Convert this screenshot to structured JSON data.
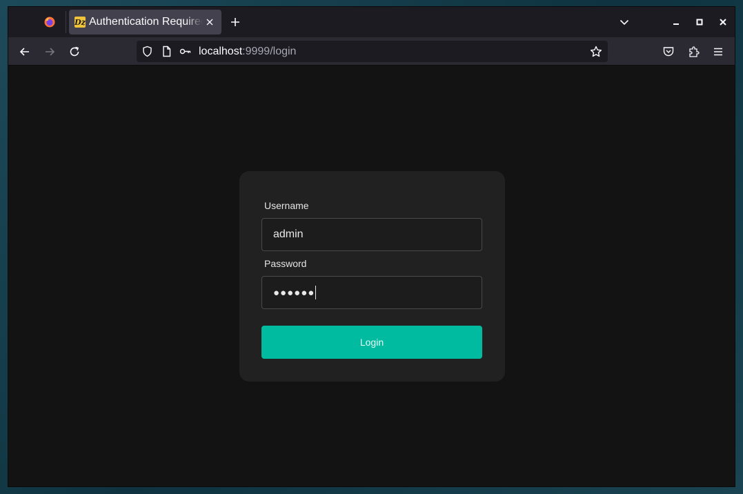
{
  "browser": {
    "tab": {
      "title": "Authentication Required",
      "favicon_text": "Dz"
    },
    "url": {
      "host": "localhost",
      "rest": ":9999/login"
    }
  },
  "login": {
    "username_label": "Username",
    "username_value": "admin",
    "password_label": "Password",
    "password_mask": "●●●●●●",
    "button_label": "Login"
  },
  "colors": {
    "accent": "#00bba0",
    "card": "#212121",
    "page": "#131313"
  },
  "icons": {
    "browser": "firefox-icon",
    "nav": [
      "back-arrow-icon",
      "forward-arrow-icon",
      "reload-icon"
    ],
    "url": [
      "shield-icon",
      "page-icon",
      "key-icon",
      "star-icon"
    ],
    "toolbar": [
      "pocket-icon",
      "extensions-icon",
      "menu-icon"
    ]
  }
}
